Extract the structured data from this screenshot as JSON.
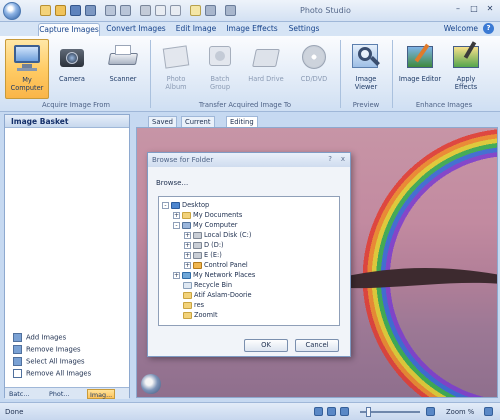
{
  "window": {
    "title": "Photo Studio"
  },
  "tabs": [
    {
      "label": "Capture Images"
    },
    {
      "label": "Convert Images"
    },
    {
      "label": "Edit Image"
    },
    {
      "label": "Image Effects"
    },
    {
      "label": "Settings"
    }
  ],
  "help": {
    "welcome": "Welcome",
    "icon_text": "?"
  },
  "ribbon": {
    "buttons": [
      {
        "label": "My Computer",
        "icon": "computer-icon"
      },
      {
        "label": "Camera",
        "icon": "camera-icon"
      },
      {
        "label": "Scanner",
        "icon": "scanner-icon"
      },
      {
        "label": "Photo Album",
        "icon": "album-icon"
      },
      {
        "label": "Batch Group",
        "icon": "batch-icon"
      },
      {
        "label": "Hard Drive",
        "icon": "hard-drive-icon"
      },
      {
        "label": "CD/DVD",
        "icon": "cd-icon"
      },
      {
        "label": "Image Viewer",
        "icon": "magnifier-icon"
      },
      {
        "label": "Image Editor",
        "icon": "editor-icon"
      },
      {
        "label": "Apply Effects",
        "icon": "effects-icon"
      }
    ],
    "groups": [
      {
        "label": "Acquire Image From"
      },
      {
        "label": "Transfer Acquired Image To"
      },
      {
        "label": "Preview"
      },
      {
        "label": "Enhance Images"
      }
    ]
  },
  "left_panel": {
    "title": "Image Basket",
    "tasks": [
      {
        "label": "Add Images"
      },
      {
        "label": "Remove Images"
      },
      {
        "label": "Select All Images"
      },
      {
        "label": "Remove All Images"
      }
    ],
    "tabs": [
      {
        "label": "Batc..."
      },
      {
        "label": "Phot..."
      },
      {
        "label": "Imag..."
      }
    ]
  },
  "view_tabs": [
    {
      "label": "Saved"
    },
    {
      "label": "Current"
    },
    {
      "label": "Editing"
    }
  ],
  "dialog": {
    "title": "Browse for Folder",
    "help_icon": "?",
    "close_icon": "x",
    "prompt": "Browse...",
    "tree": [
      {
        "label": "Desktop",
        "icon": "desktop-icon"
      },
      {
        "label": "My Documents",
        "icon": "folder-icon"
      },
      {
        "label": "My Computer",
        "icon": "computer-icon"
      },
      {
        "label": "Local Disk (C:)",
        "icon": "drive-icon"
      },
      {
        "label": "D (D:)",
        "icon": "drive-icon"
      },
      {
        "label": "E (E:)",
        "icon": "drive-icon"
      },
      {
        "label": "Control Panel",
        "icon": "control-panel-icon"
      },
      {
        "label": "My Network Places",
        "icon": "network-icon"
      },
      {
        "label": "Recycle Bin",
        "icon": "recycle-bin-icon"
      },
      {
        "label": "Atif Aslam-Doorie",
        "icon": "folder-icon"
      },
      {
        "label": "res",
        "icon": "folder-icon"
      },
      {
        "label": "ZoomIt",
        "icon": "folder-icon"
      }
    ],
    "ok_label": "OK",
    "cancel_label": "Cancel"
  },
  "statusbar": {
    "status": "Done",
    "zoom": "Zoom %"
  }
}
